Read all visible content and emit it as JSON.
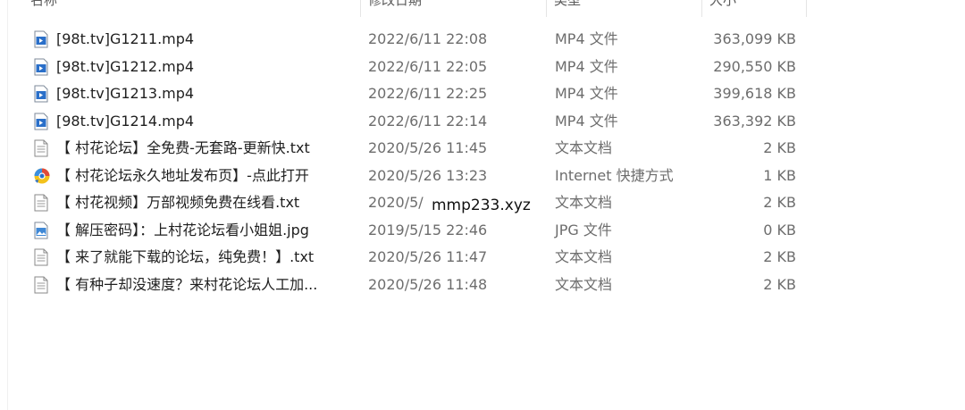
{
  "columns": {
    "name": "名称",
    "date": "修改日期",
    "type": "类型",
    "size": "大小"
  },
  "files": [
    {
      "name": "[98t.tv]G1211.mp4",
      "date": "2022/6/11 22:08",
      "type": "MP4 文件",
      "size": "363,099 KB",
      "icon": "video-file-icon"
    },
    {
      "name": "[98t.tv]G1212.mp4",
      "date": "2022/6/11 22:05",
      "type": "MP4 文件",
      "size": "290,550 KB",
      "icon": "video-file-icon"
    },
    {
      "name": "[98t.tv]G1213.mp4",
      "date": "2022/6/11 22:25",
      "type": "MP4 文件",
      "size": "399,618 KB",
      "icon": "video-file-icon"
    },
    {
      "name": "[98t.tv]G1214.mp4",
      "date": "2022/6/11 22:14",
      "type": "MP4 文件",
      "size": "363,392 KB",
      "icon": "video-file-icon"
    },
    {
      "name": "【 村花论坛】全免费-无套路-更新快.txt",
      "date": "2020/5/26 11:45",
      "type": "文本文档",
      "size": "2 KB",
      "icon": "text-file-icon"
    },
    {
      "name": "【 村花论坛永久地址发布页】-点此打开",
      "date": "2020/5/26 13:23",
      "type": "Internet 快捷方式",
      "size": "1 KB",
      "icon": "internet-shortcut-icon"
    },
    {
      "name": "【 村花视频】万部视频免费在线看.txt",
      "date": "2020/5/",
      "type": "文本文档",
      "size": "2 KB",
      "icon": "text-file-icon"
    },
    {
      "name": "【 解压密码】：上村花论坛看小姐姐.jpg",
      "date": "2019/5/15 22:46",
      "type": "JPG 文件",
      "size": "0 KB",
      "icon": "image-file-icon"
    },
    {
      "name": "【 来了就能下载的论坛，纯免费！】.txt",
      "date": "2020/5/26 11:47",
      "type": "文本文档",
      "size": "2 KB",
      "icon": "text-file-icon"
    },
    {
      "name": "【 有种子却没速度？来村花论坛人工加...",
      "date": "2020/5/26 11:48",
      "type": "文本文档",
      "size": "2 KB",
      "icon": "text-file-icon"
    }
  ],
  "overlay": "mmp233.xyz",
  "colors": {
    "video_icon": "#2a6fc9",
    "text_icon_border": "#8a8a8a",
    "secondary_text": "#6d6d6d"
  }
}
